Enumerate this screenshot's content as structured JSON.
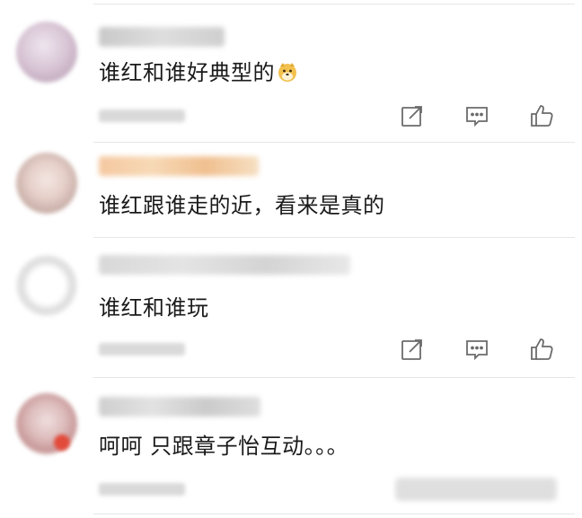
{
  "colors": {
    "text": "#1a1a1a",
    "icon": "#6b6b6b",
    "divider": "#e6e6e6"
  },
  "comments": [
    {
      "text": "谁红和谁好典型的",
      "emoji": "doge-emoji-icon",
      "actions": [
        "share-icon",
        "comment-icon",
        "like-icon"
      ]
    },
    {
      "text": "谁红跟谁走的近，看来是真的"
    },
    {
      "text": "谁红和谁玩",
      "actions": [
        "share-icon",
        "comment-icon",
        "like-icon"
      ]
    },
    {
      "text": "呵呵 只跟章子怡互动。。。"
    }
  ]
}
